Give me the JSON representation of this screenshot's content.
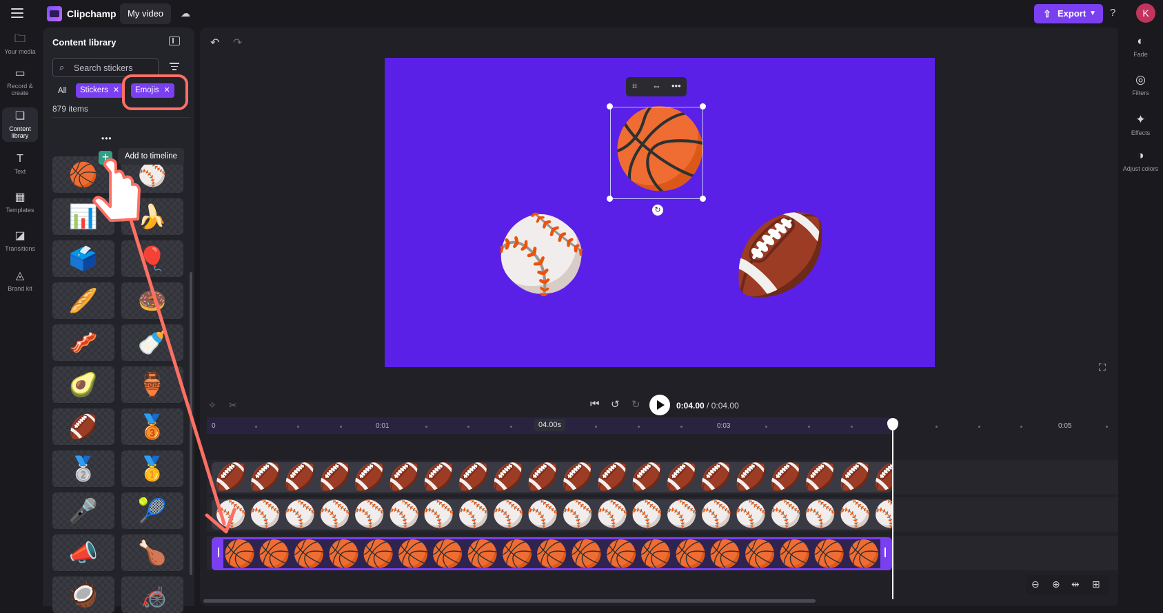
{
  "app": {
    "name": "Clipchamp",
    "project_name": "My video"
  },
  "topbar": {
    "export_label": "Export",
    "help": "?",
    "avatar_initial": "K"
  },
  "left_rail": [
    {
      "label": "Your media",
      "icon": "folder-icon"
    },
    {
      "label": "Record & create",
      "icon": "camera-icon"
    },
    {
      "label": "Content library",
      "icon": "library-icon",
      "active": true
    },
    {
      "label": "Text",
      "icon": "text-icon"
    },
    {
      "label": "Templates",
      "icon": "templates-icon"
    },
    {
      "label": "Transitions",
      "icon": "transitions-icon"
    },
    {
      "label": "Brand kit",
      "icon": "brand-kit-icon"
    }
  ],
  "library": {
    "title": "Content library",
    "search_placeholder": "Search stickers",
    "filters": {
      "all": "All",
      "stickers": "Stickers",
      "emojis": "Emojis"
    },
    "count": "879 items",
    "tooltip": "Add to timeline",
    "tiles": [
      "🏀",
      "⚾",
      "📊",
      "🍌",
      "🗳️",
      "🎈",
      "🥖",
      "🍩",
      "🥓",
      "🍼",
      "🥑",
      "🏺",
      "🏈",
      "🥉",
      "🥈",
      "🥇",
      "🎤",
      "🎾",
      "📣",
      "🍗",
      "🥥",
      "🦽"
    ]
  },
  "right_rail": [
    {
      "label": "Fade",
      "icon": "fade-icon"
    },
    {
      "label": "Filters",
      "icon": "filters-icon"
    },
    {
      "label": "Effects",
      "icon": "effects-icon"
    },
    {
      "label": "Adjust colors",
      "icon": "adjust-colors-icon"
    }
  ],
  "canvas": {
    "background": "#5a20e8",
    "items": [
      "🏀",
      "⚾",
      "🏈"
    ]
  },
  "playback": {
    "current": "0:04.00",
    "separator": " / ",
    "total": "0:04.00"
  },
  "ruler": {
    "labels": [
      "0",
      "0:01",
      "0:03",
      "0:05"
    ],
    "duration_badge": "04.00s"
  },
  "tracks": [
    {
      "emoji": "🏈",
      "selected": false
    },
    {
      "emoji": "⚾",
      "selected": false
    },
    {
      "emoji": "🏀",
      "selected": true
    }
  ],
  "colors": {
    "accent": "#7b3ff2",
    "annotation": "#ff6f63",
    "bg": "#1a1a1e"
  }
}
